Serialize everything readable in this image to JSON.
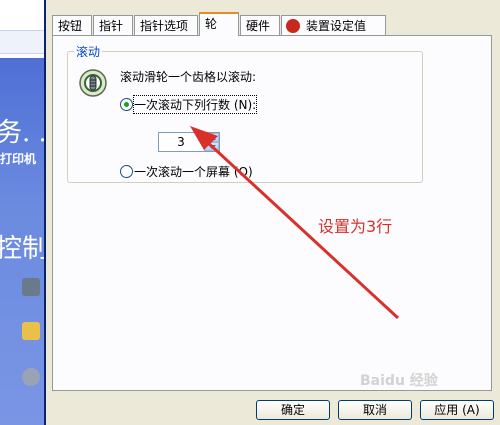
{
  "background_window": {
    "text_large_1": "务. .",
    "text_small": "打印机",
    "text_large_2": "控制"
  },
  "tabs": [
    "按钮",
    "指针",
    "指针选项",
    "轮",
    "硬件",
    "装置设定值"
  ],
  "active_tab": "轮",
  "group": {
    "title": "滚动",
    "description": "滚动滑轮一个齿格以滚动:",
    "option_lines": "一次滚动下列行数 (N):",
    "lines_value": "3",
    "option_screen": "一次滚动一个屏幕 (O)"
  },
  "buttons": {
    "ok": "确定",
    "cancel": "取消",
    "apply": "应用 (A)"
  },
  "annotation": "设置为3行",
  "watermark": "Baidu 经验",
  "colors": {
    "arrow": "#d9302c",
    "active_tab_border": "#e68b2c",
    "group_title": "#0046d5"
  }
}
